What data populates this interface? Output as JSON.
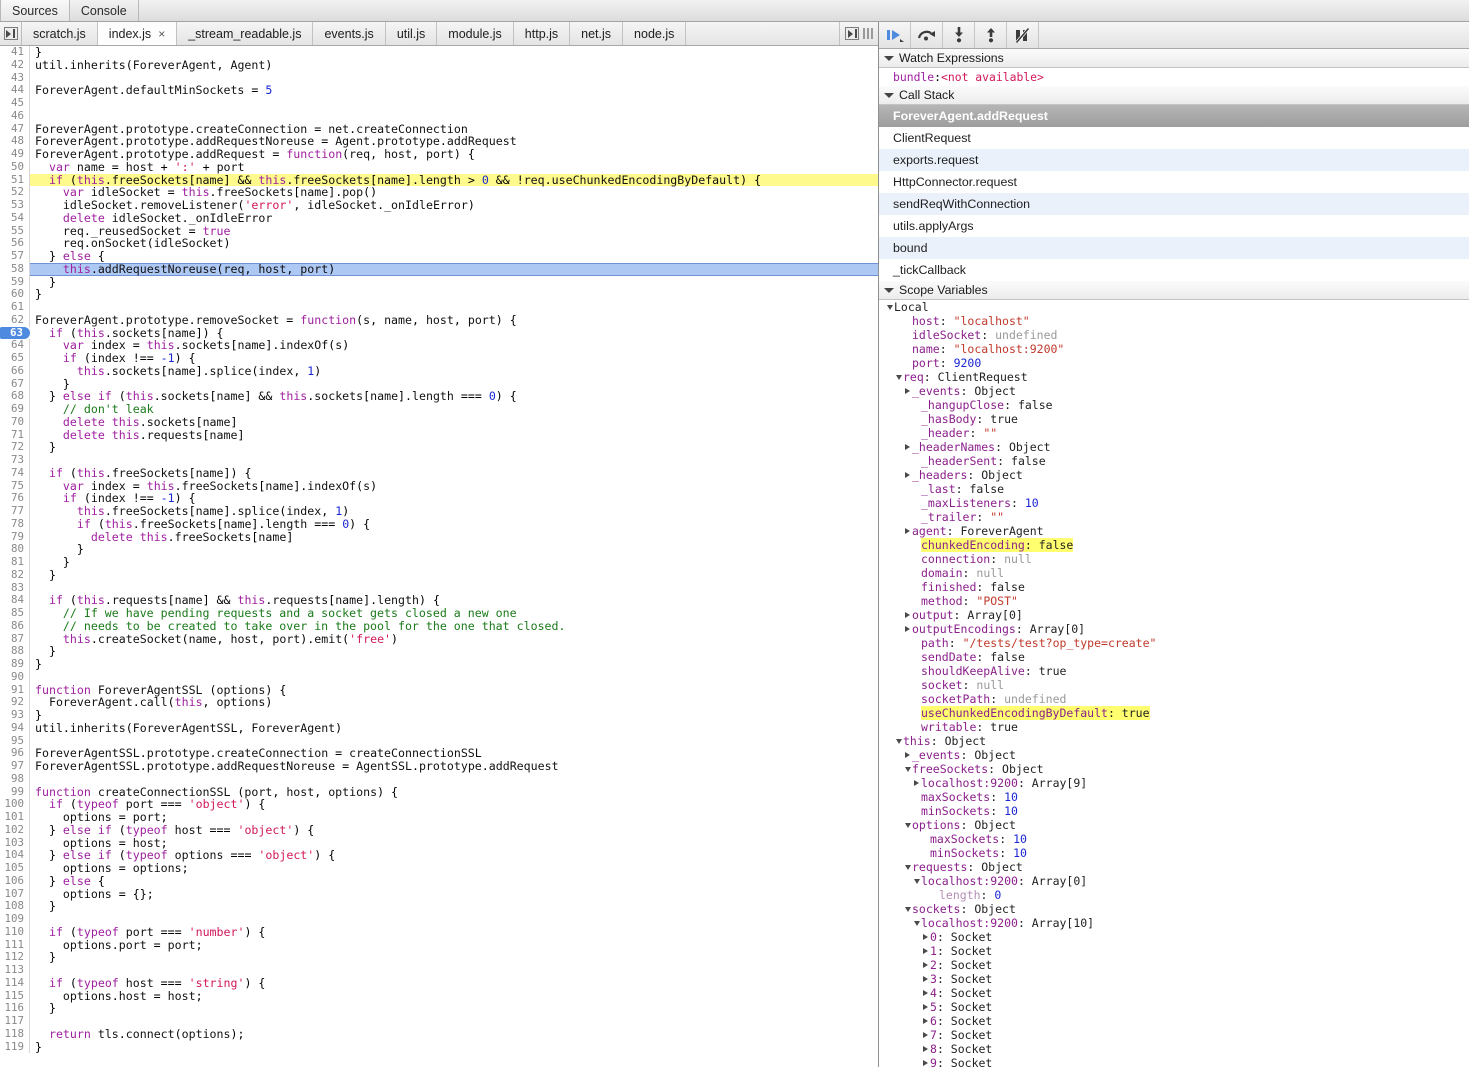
{
  "panel_tabs": [
    {
      "label": "Sources",
      "active": true
    },
    {
      "label": "Console",
      "active": false
    }
  ],
  "file_tabs": [
    {
      "label": "scratch.js",
      "active": false,
      "closable": false
    },
    {
      "label": "index.js",
      "active": true,
      "closable": true,
      "close_glyph": "×"
    },
    {
      "label": "_stream_readable.js",
      "active": false,
      "closable": false
    },
    {
      "label": "events.js",
      "active": false,
      "closable": false
    },
    {
      "label": "util.js",
      "active": false,
      "closable": false
    },
    {
      "label": "module.js",
      "active": false,
      "closable": false
    },
    {
      "label": "http.js",
      "active": false,
      "closable": false
    },
    {
      "label": "net.js",
      "active": false,
      "closable": false
    },
    {
      "label": "node.js",
      "active": false,
      "closable": false
    }
  ],
  "debugger_toolbar": [
    {
      "name": "resume-script-execution",
      "title": "Resume script execution"
    },
    {
      "name": "step-over-next-function-call",
      "title": "Step over next function call"
    },
    {
      "name": "step-into-next-function-call",
      "title": "Step into next function call"
    },
    {
      "name": "step-out-of-current-function",
      "title": "Step out of current function"
    },
    {
      "name": "deactivate-breakpoints",
      "title": "Deactivate breakpoints"
    }
  ],
  "watch": {
    "title": "Watch Expressions",
    "rows": [
      {
        "name": "bundle",
        "value": "<not available>"
      }
    ]
  },
  "call_stack": {
    "title": "Call Stack",
    "frames": [
      {
        "label": "ForeverAgent.addRequest",
        "selected": true
      },
      {
        "label": "ClientRequest",
        "selected": false
      },
      {
        "label": "exports.request",
        "selected": false
      },
      {
        "label": "HttpConnector.request",
        "selected": false
      },
      {
        "label": "sendReqWithConnection",
        "selected": false
      },
      {
        "label": "utils.applyArgs",
        "selected": false
      },
      {
        "label": "bound",
        "selected": false
      },
      {
        "label": "_tickCallback",
        "selected": false
      }
    ]
  },
  "scope": {
    "title": "Scope Variables",
    "rows": [
      {
        "indent": 0,
        "arrow": "down",
        "key": "Local",
        "sep": "",
        "val": "",
        "vtype": "root"
      },
      {
        "indent": 2,
        "arrow": "none",
        "key": "host",
        "sep": ": ",
        "val": "\"localhost\"",
        "vtype": "str"
      },
      {
        "indent": 2,
        "arrow": "none",
        "key": "idleSocket",
        "sep": ": ",
        "val": "undefined",
        "vtype": "undef"
      },
      {
        "indent": 2,
        "arrow": "none",
        "key": "name",
        "sep": ": ",
        "val": "\"localhost:9200\"",
        "vtype": "str"
      },
      {
        "indent": 2,
        "arrow": "none",
        "key": "port",
        "sep": ": ",
        "val": "9200",
        "vtype": "num"
      },
      {
        "indent": 1,
        "arrow": "down",
        "key": "req",
        "sep": ": ",
        "val": "ClientRequest",
        "vtype": "obj"
      },
      {
        "indent": 2,
        "arrow": "right",
        "key": "_events",
        "sep": ": ",
        "val": "Object",
        "vtype": "obj"
      },
      {
        "indent": 3,
        "arrow": "none",
        "key": "_hangupClose",
        "sep": ": ",
        "val": "false",
        "vtype": "bool"
      },
      {
        "indent": 3,
        "arrow": "none",
        "key": "_hasBody",
        "sep": ": ",
        "val": "true",
        "vtype": "bool"
      },
      {
        "indent": 3,
        "arrow": "none",
        "key": "_header",
        "sep": ": ",
        "val": "\"\"",
        "vtype": "str"
      },
      {
        "indent": 2,
        "arrow": "right",
        "key": "_headerNames",
        "sep": ": ",
        "val": "Object",
        "vtype": "obj"
      },
      {
        "indent": 3,
        "arrow": "none",
        "key": "_headerSent",
        "sep": ": ",
        "val": "false",
        "vtype": "bool"
      },
      {
        "indent": 2,
        "arrow": "right",
        "key": "_headers",
        "sep": ": ",
        "val": "Object",
        "vtype": "obj"
      },
      {
        "indent": 3,
        "arrow": "none",
        "key": "_last",
        "sep": ": ",
        "val": "false",
        "vtype": "bool"
      },
      {
        "indent": 3,
        "arrow": "none",
        "key": "_maxListeners",
        "sep": ": ",
        "val": "10",
        "vtype": "num"
      },
      {
        "indent": 3,
        "arrow": "none",
        "key": "_trailer",
        "sep": ": ",
        "val": "\"\"",
        "vtype": "str"
      },
      {
        "indent": 2,
        "arrow": "right",
        "key": "agent",
        "sep": ": ",
        "val": "ForeverAgent",
        "vtype": "obj"
      },
      {
        "indent": 3,
        "arrow": "none",
        "key": "chunkedEncoding",
        "sep": ": ",
        "val": "false",
        "vtype": "bool",
        "highlight": true
      },
      {
        "indent": 3,
        "arrow": "none",
        "key": "connection",
        "sep": ": ",
        "val": "null",
        "vtype": "null"
      },
      {
        "indent": 3,
        "arrow": "none",
        "key": "domain",
        "sep": ": ",
        "val": "null",
        "vtype": "null"
      },
      {
        "indent": 3,
        "arrow": "none",
        "key": "finished",
        "sep": ": ",
        "val": "false",
        "vtype": "bool"
      },
      {
        "indent": 3,
        "arrow": "none",
        "key": "method",
        "sep": ": ",
        "val": "\"POST\"",
        "vtype": "str"
      },
      {
        "indent": 2,
        "arrow": "right",
        "key": "output",
        "sep": ": ",
        "val": "Array[0]",
        "vtype": "obj"
      },
      {
        "indent": 2,
        "arrow": "right",
        "key": "outputEncodings",
        "sep": ": ",
        "val": "Array[0]",
        "vtype": "obj"
      },
      {
        "indent": 3,
        "arrow": "none",
        "key": "path",
        "sep": ": ",
        "val": "\"/tests/test?op_type=create\"",
        "vtype": "str"
      },
      {
        "indent": 3,
        "arrow": "none",
        "key": "sendDate",
        "sep": ": ",
        "val": "false",
        "vtype": "bool"
      },
      {
        "indent": 3,
        "arrow": "none",
        "key": "shouldKeepAlive",
        "sep": ": ",
        "val": "true",
        "vtype": "bool"
      },
      {
        "indent": 3,
        "arrow": "none",
        "key": "socket",
        "sep": ": ",
        "val": "null",
        "vtype": "null"
      },
      {
        "indent": 3,
        "arrow": "none",
        "key": "socketPath",
        "sep": ": ",
        "val": "undefined",
        "vtype": "undef"
      },
      {
        "indent": 3,
        "arrow": "none",
        "key": "useChunkedEncodingByDefault",
        "sep": ": ",
        "val": "true",
        "vtype": "bool",
        "highlight": true
      },
      {
        "indent": 3,
        "arrow": "none",
        "key": "writable",
        "sep": ": ",
        "val": "true",
        "vtype": "bool"
      },
      {
        "indent": 1,
        "arrow": "down",
        "key": "this",
        "sep": ": ",
        "val": "Object",
        "vtype": "obj"
      },
      {
        "indent": 2,
        "arrow": "right",
        "key": "_events",
        "sep": ": ",
        "val": "Object",
        "vtype": "obj"
      },
      {
        "indent": 2,
        "arrow": "down",
        "key": "freeSockets",
        "sep": ": ",
        "val": "Object",
        "vtype": "obj"
      },
      {
        "indent": 3,
        "arrow": "right",
        "key": "localhost:9200",
        "sep": ": ",
        "val": "Array[9]",
        "vtype": "obj"
      },
      {
        "indent": 3,
        "arrow": "none",
        "key": "maxSockets",
        "sep": ": ",
        "val": "10",
        "vtype": "num"
      },
      {
        "indent": 3,
        "arrow": "none",
        "key": "minSockets",
        "sep": ": ",
        "val": "10",
        "vtype": "num"
      },
      {
        "indent": 2,
        "arrow": "down",
        "key": "options",
        "sep": ": ",
        "val": "Object",
        "vtype": "obj"
      },
      {
        "indent": 4,
        "arrow": "none",
        "key": "maxSockets",
        "sep": ": ",
        "val": "10",
        "vtype": "num"
      },
      {
        "indent": 4,
        "arrow": "none",
        "key": "minSockets",
        "sep": ": ",
        "val": "10",
        "vtype": "num"
      },
      {
        "indent": 2,
        "arrow": "down",
        "key": "requests",
        "sep": ": ",
        "val": "Object",
        "vtype": "obj"
      },
      {
        "indent": 3,
        "arrow": "down",
        "key": "localhost:9200",
        "sep": ": ",
        "val": "Array[0]",
        "vtype": "obj"
      },
      {
        "indent": 5,
        "arrow": "none",
        "key": "length",
        "sep": ": ",
        "val": "0",
        "vtype": "num",
        "dim": true
      },
      {
        "indent": 2,
        "arrow": "down",
        "key": "sockets",
        "sep": ": ",
        "val": "Object",
        "vtype": "obj"
      },
      {
        "indent": 3,
        "arrow": "down",
        "key": "localhost:9200",
        "sep": ": ",
        "val": "Array[10]",
        "vtype": "obj"
      },
      {
        "indent": 4,
        "arrow": "right",
        "key": "0",
        "sep": ": ",
        "val": "Socket",
        "vtype": "obj"
      },
      {
        "indent": 4,
        "arrow": "right",
        "key": "1",
        "sep": ": ",
        "val": "Socket",
        "vtype": "obj"
      },
      {
        "indent": 4,
        "arrow": "right",
        "key": "2",
        "sep": ": ",
        "val": "Socket",
        "vtype": "obj"
      },
      {
        "indent": 4,
        "arrow": "right",
        "key": "3",
        "sep": ": ",
        "val": "Socket",
        "vtype": "obj"
      },
      {
        "indent": 4,
        "arrow": "right",
        "key": "4",
        "sep": ": ",
        "val": "Socket",
        "vtype": "obj"
      },
      {
        "indent": 4,
        "arrow": "right",
        "key": "5",
        "sep": ": ",
        "val": "Socket",
        "vtype": "obj"
      },
      {
        "indent": 4,
        "arrow": "right",
        "key": "6",
        "sep": ": ",
        "val": "Socket",
        "vtype": "obj"
      },
      {
        "indent": 4,
        "arrow": "right",
        "key": "7",
        "sep": ": ",
        "val": "Socket",
        "vtype": "obj"
      },
      {
        "indent": 4,
        "arrow": "right",
        "key": "8",
        "sep": ": ",
        "val": "Socket",
        "vtype": "obj"
      },
      {
        "indent": 4,
        "arrow": "right",
        "key": "9",
        "sep": ": ",
        "val": "Socket",
        "vtype": "obj"
      }
    ]
  },
  "editor": {
    "file": "index.js",
    "execution_line": 58,
    "breakpoint_lines": [
      63
    ],
    "search_highlight_line": 51,
    "first_visible_line": 41,
    "lines": [
      {
        "n": 41,
        "t": "}"
      },
      {
        "n": 42,
        "t": "util.inherits(ForeverAgent, Agent)"
      },
      {
        "n": 43,
        "t": ""
      },
      {
        "n": 44,
        "t": "ForeverAgent.defaultMinSockets = 5"
      },
      {
        "n": 45,
        "t": ""
      },
      {
        "n": 46,
        "t": ""
      },
      {
        "n": 47,
        "t": "ForeverAgent.prototype.createConnection = net.createConnection"
      },
      {
        "n": 48,
        "t": "ForeverAgent.prototype.addRequestNoreuse = Agent.prototype.addRequest"
      },
      {
        "n": 49,
        "t": "ForeverAgent.prototype.addRequest = function(req, host, port) {"
      },
      {
        "n": 50,
        "t": "  var name = host + ':' + port"
      },
      {
        "n": 51,
        "t": "  if (this.freeSockets[name] && this.freeSockets[name].length > 0 && !req.useChunkedEncodingByDefault) {"
      },
      {
        "n": 52,
        "t": "    var idleSocket = this.freeSockets[name].pop()"
      },
      {
        "n": 53,
        "t": "    idleSocket.removeListener('error', idleSocket._onIdleError)"
      },
      {
        "n": 54,
        "t": "    delete idleSocket._onIdleError"
      },
      {
        "n": 55,
        "t": "    req._reusedSocket = true"
      },
      {
        "n": 56,
        "t": "    req.onSocket(idleSocket)"
      },
      {
        "n": 57,
        "t": "  } else {"
      },
      {
        "n": 58,
        "t": "    this.addRequestNoreuse(req, host, port)"
      },
      {
        "n": 59,
        "t": "  }"
      },
      {
        "n": 60,
        "t": "}"
      },
      {
        "n": 61,
        "t": ""
      },
      {
        "n": 62,
        "t": "ForeverAgent.prototype.removeSocket = function(s, name, host, port) {"
      },
      {
        "n": 63,
        "t": "  if (this.sockets[name]) {"
      },
      {
        "n": 64,
        "t": "    var index = this.sockets[name].indexOf(s)"
      },
      {
        "n": 65,
        "t": "    if (index !== -1) {"
      },
      {
        "n": 66,
        "t": "      this.sockets[name].splice(index, 1)"
      },
      {
        "n": 67,
        "t": "    }"
      },
      {
        "n": 68,
        "t": "  } else if (this.sockets[name] && this.sockets[name].length === 0) {"
      },
      {
        "n": 69,
        "t": "    // don't leak"
      },
      {
        "n": 70,
        "t": "    delete this.sockets[name]"
      },
      {
        "n": 71,
        "t": "    delete this.requests[name]"
      },
      {
        "n": 72,
        "t": "  }"
      },
      {
        "n": 73,
        "t": ""
      },
      {
        "n": 74,
        "t": "  if (this.freeSockets[name]) {"
      },
      {
        "n": 75,
        "t": "    var index = this.freeSockets[name].indexOf(s)"
      },
      {
        "n": 76,
        "t": "    if (index !== -1) {"
      },
      {
        "n": 77,
        "t": "      this.freeSockets[name].splice(index, 1)"
      },
      {
        "n": 78,
        "t": "      if (this.freeSockets[name].length === 0) {"
      },
      {
        "n": 79,
        "t": "        delete this.freeSockets[name]"
      },
      {
        "n": 80,
        "t": "      }"
      },
      {
        "n": 81,
        "t": "    }"
      },
      {
        "n": 82,
        "t": "  }"
      },
      {
        "n": 83,
        "t": ""
      },
      {
        "n": 84,
        "t": "  if (this.requests[name] && this.requests[name].length) {"
      },
      {
        "n": 85,
        "t": "    // If we have pending requests and a socket gets closed a new one"
      },
      {
        "n": 86,
        "t": "    // needs to be created to take over in the pool for the one that closed."
      },
      {
        "n": 87,
        "t": "    this.createSocket(name, host, port).emit('free')"
      },
      {
        "n": 88,
        "t": "  }"
      },
      {
        "n": 89,
        "t": "}"
      },
      {
        "n": 90,
        "t": ""
      },
      {
        "n": 91,
        "t": "function ForeverAgentSSL (options) {"
      },
      {
        "n": 92,
        "t": "  ForeverAgent.call(this, options)"
      },
      {
        "n": 93,
        "t": "}"
      },
      {
        "n": 94,
        "t": "util.inherits(ForeverAgentSSL, ForeverAgent)"
      },
      {
        "n": 95,
        "t": ""
      },
      {
        "n": 96,
        "t": "ForeverAgentSSL.prototype.createConnection = createConnectionSSL"
      },
      {
        "n": 97,
        "t": "ForeverAgentSSL.prototype.addRequestNoreuse = AgentSSL.prototype.addRequest"
      },
      {
        "n": 98,
        "t": ""
      },
      {
        "n": 99,
        "t": "function createConnectionSSL (port, host, options) {"
      },
      {
        "n": 100,
        "t": "  if (typeof port === 'object') {"
      },
      {
        "n": 101,
        "t": "    options = port;"
      },
      {
        "n": 102,
        "t": "  } else if (typeof host === 'object') {"
      },
      {
        "n": 103,
        "t": "    options = host;"
      },
      {
        "n": 104,
        "t": "  } else if (typeof options === 'object') {"
      },
      {
        "n": 105,
        "t": "    options = options;"
      },
      {
        "n": 106,
        "t": "  } else {"
      },
      {
        "n": 107,
        "t": "    options = {};"
      },
      {
        "n": 108,
        "t": "  }"
      },
      {
        "n": 109,
        "t": ""
      },
      {
        "n": 110,
        "t": "  if (typeof port === 'number') {"
      },
      {
        "n": 111,
        "t": "    options.port = port;"
      },
      {
        "n": 112,
        "t": "  }"
      },
      {
        "n": 113,
        "t": ""
      },
      {
        "n": 114,
        "t": "  if (typeof host === 'string') {"
      },
      {
        "n": 115,
        "t": "    options.host = host;"
      },
      {
        "n": 116,
        "t": "  }"
      },
      {
        "n": 117,
        "t": ""
      },
      {
        "n": 118,
        "t": "  return tls.connect(options);"
      },
      {
        "n": 119,
        "t": "}"
      }
    ]
  },
  "colors": {
    "breakpoint": "#4d8ae0",
    "execution_line": "#aec8f4",
    "search_highlight": "#fffa8c",
    "scope_highlight": "#ffff70",
    "accent": "#4d8ae0"
  }
}
